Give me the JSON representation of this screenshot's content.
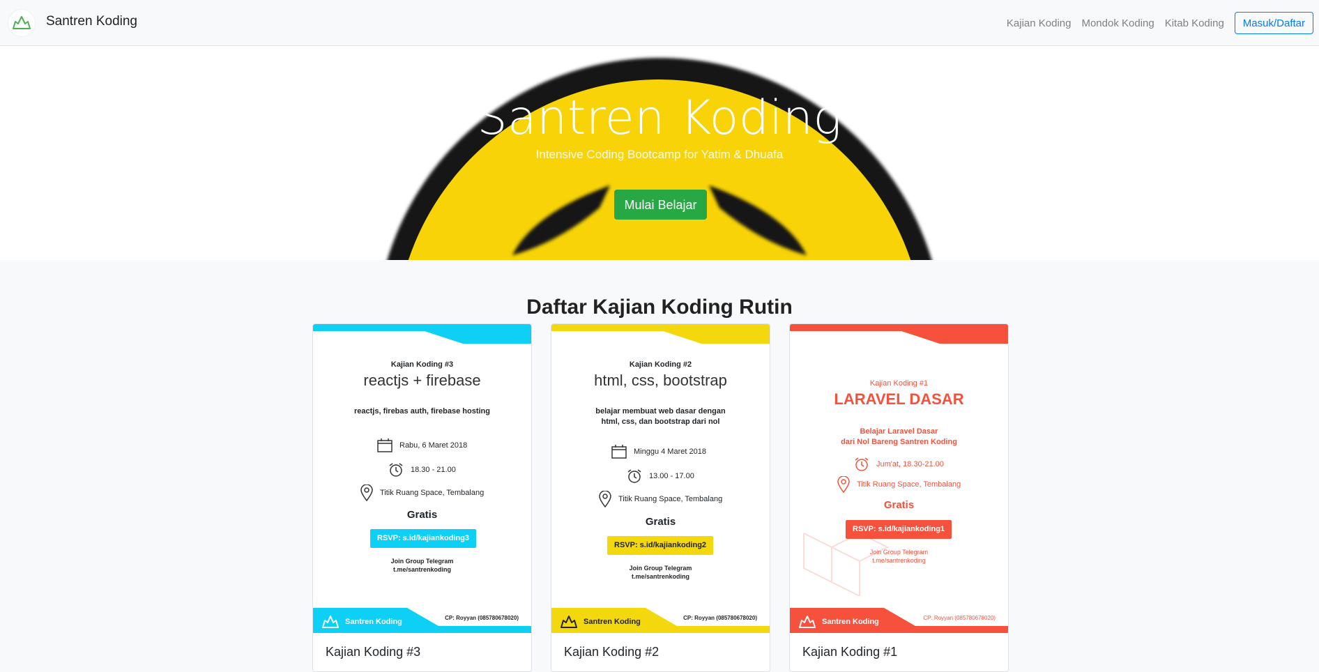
{
  "nav": {
    "brand": "Santren Koding",
    "links": [
      "Kajian Koding",
      "Mondok Koding",
      "Kitab Koding"
    ],
    "login": "Masuk/Daftar"
  },
  "hero": {
    "title": "Santren Koding",
    "subtitle": "Intensive Coding Bootcamp for Yatim & Dhuafa",
    "cta": "Mulai Belajar"
  },
  "section": {
    "title": "Daftar Kajian Koding Rutin"
  },
  "cards": [
    {
      "accent": "#0ed0f4",
      "title": "Kajian Koding #3",
      "poster": {
        "kicker": "Kajian Koding #3",
        "topic": "reactjs + firebase",
        "desc1": "reactjs, firebas auth, firebase hosting",
        "desc2": "",
        "date": "Rabu,  6 Maret 2018",
        "time": "18.30 - 21.00",
        "place": "Titik Ruang Space, Tembalang",
        "gratis": "Gratis",
        "rsvp": "RSVP: s.id/kajiankoding3",
        "join1": "Join Group Telegram",
        "join2": "t.me/santrenkoding",
        "brand": "Santren Koding",
        "cp": "CP: Royyan (085780678020)"
      }
    },
    {
      "accent": "#f4d80e",
      "title": "Kajian Koding #2",
      "poster": {
        "kicker": "Kajian Koding #2",
        "topic": "html, css, bootstrap",
        "desc1": "belajar membuat web dasar dengan",
        "desc2": "html, css, dan bootstrap dari nol",
        "date": "Minggu  4 Maret 2018",
        "time": "13.00 - 17.00",
        "place": "Titik Ruang Space, Tembalang",
        "gratis": "Gratis",
        "rsvp": "RSVP: s.id/kajiankoding2",
        "join1": "Join Group Telegram",
        "join2": "t.me/santrenkoding",
        "brand": "Santren Koding",
        "cp": "CP: Royyan (085780678020)"
      }
    },
    {
      "accent": "#f5513c",
      "title": "Kajian Koding #1",
      "poster": {
        "kicker": "Kajian Koding #1",
        "topic": "LARAVEL DASAR",
        "desc1": "Belajar Laravel Dasar",
        "desc2": "dari Nol Bareng Santren Koding",
        "date": "",
        "time": "Jum'at, 18.30-21.00",
        "place": "Titik Ruang Space, Tembalang",
        "gratis": "Gratis",
        "rsvp": "RSVP: s.id/kajiankoding1",
        "join1": "Join Group Telegram",
        "join2": "t.me/santrenkoding",
        "brand": "Santren Koding",
        "cp": "CP: Royyan (085780678020)"
      }
    }
  ]
}
